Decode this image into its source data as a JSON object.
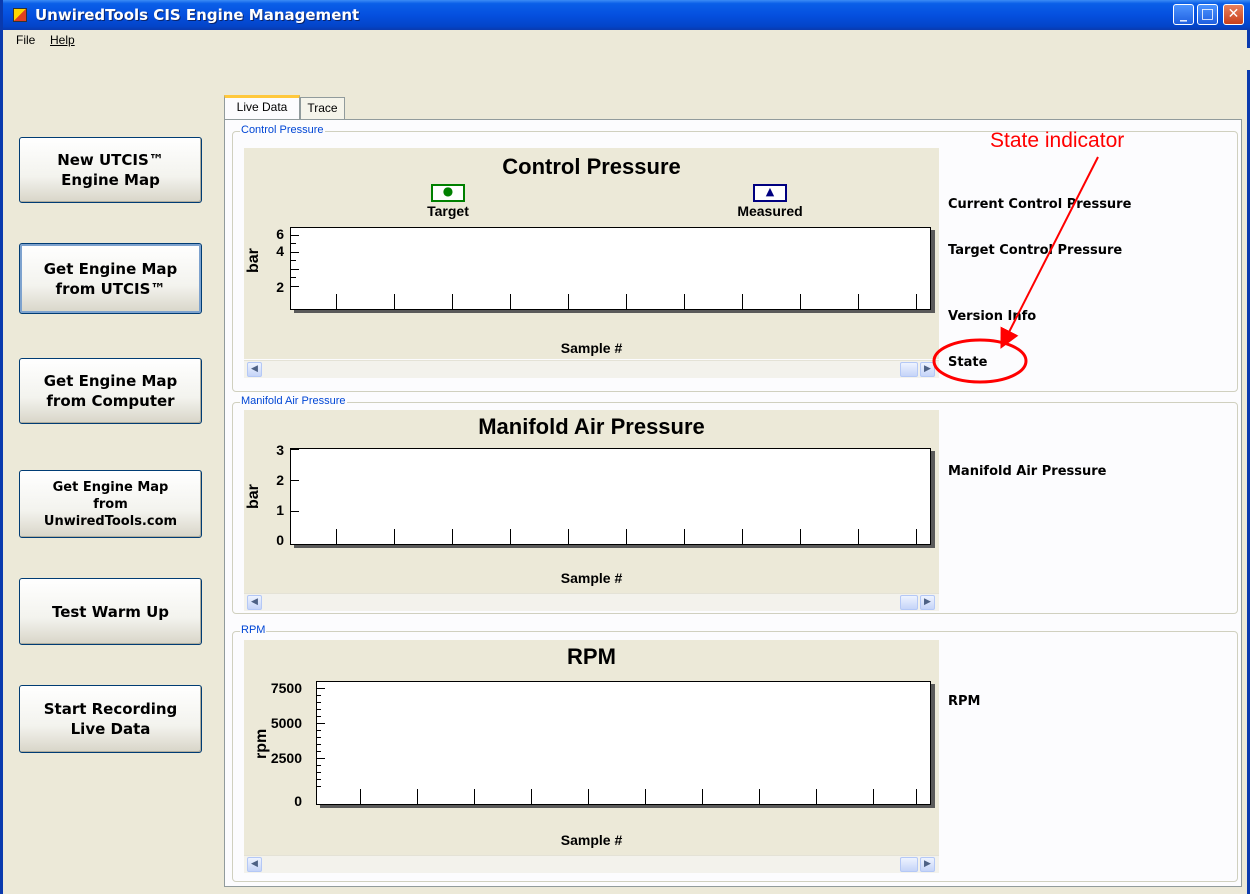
{
  "window": {
    "title": "UnwiredTools CIS Engine Management",
    "min_glyph": "_",
    "max_glyph": "□",
    "close_glyph": "✕"
  },
  "menu": {
    "file": "File",
    "help": "Help"
  },
  "sidebar": {
    "btn1": [
      "New UTCIS™",
      "Engine Map"
    ],
    "btn2": [
      "Get Engine Map",
      "from UTCIS™"
    ],
    "btn3": [
      "Get Engine Map",
      "from Computer"
    ],
    "btn4": [
      "Get Engine Map",
      "from",
      "UnwiredTools.com"
    ],
    "btn5": [
      "Test Warm Up"
    ],
    "btn6": [
      "Start Recording",
      "Live Data"
    ]
  },
  "tabs": {
    "live": "Live Data",
    "trace": "Trace"
  },
  "groups": {
    "control": "Control Pressure",
    "manifold": "Manifold Air Pressure",
    "rpm": "RPM"
  },
  "charts": {
    "control": {
      "title": "Control Pressure",
      "ylabel": "bar",
      "xlabel": "Sample #",
      "yticks": [
        "6",
        "4",
        "2"
      ],
      "legend_target": "Target",
      "legend_measured": "Measured"
    },
    "manifold": {
      "title": "Manifold Air Pressure",
      "ylabel": "bar",
      "xlabel": "Sample #",
      "yticks": [
        "3",
        "2",
        "1",
        "0"
      ]
    },
    "rpm": {
      "title": "RPM",
      "ylabel": "rpm",
      "xlabel": "Sample #",
      "yticks": [
        "7500",
        "5000",
        "2500",
        "0"
      ]
    }
  },
  "readouts": {
    "current_cp": "Current Control Pressure",
    "target_cp": "Target Control Pressure",
    "version": "Version Info",
    "state": "State",
    "map": "Manifold Air Pressure",
    "rpm": "RPM"
  },
  "annotation": {
    "text": "State indicator",
    "color": "#FF0000"
  },
  "colors": {
    "titlebar": "#0550DF",
    "target_legend": "#008000",
    "measured_legend": "#000080",
    "group_caption": "#0046D5"
  },
  "icons": {
    "scroll_left": "◀",
    "scroll_right": "▶",
    "target_marker": "●",
    "measured_marker": "▲"
  }
}
